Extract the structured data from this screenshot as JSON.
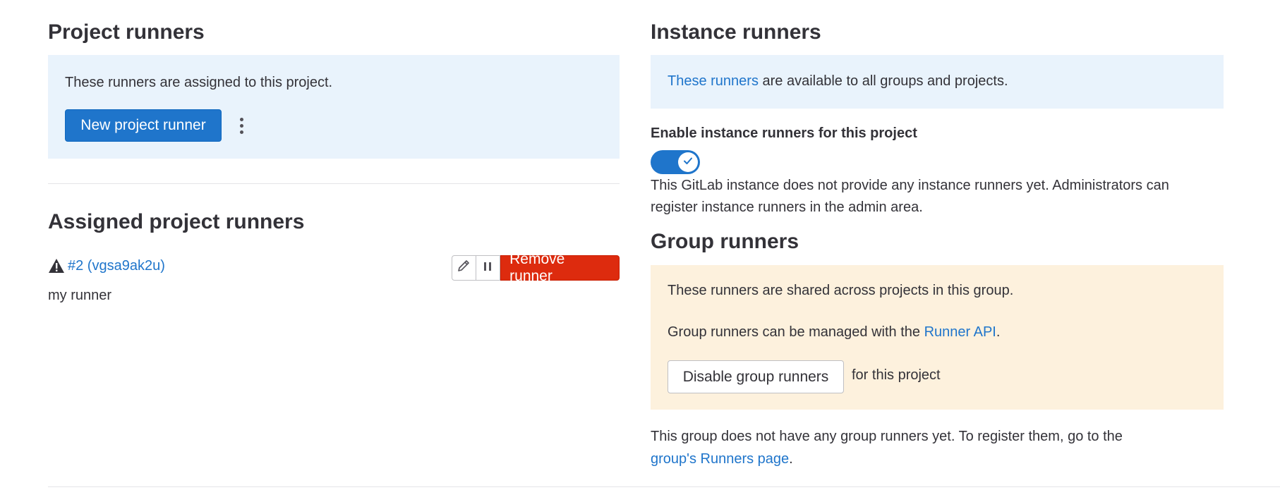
{
  "project_runners": {
    "title": "Project runners",
    "info_text": "These runners are assigned to this project.",
    "new_button": "New project runner"
  },
  "assigned": {
    "title": "Assigned project runners",
    "runner": {
      "link": "#2 (vgsa9ak2u)",
      "description": "my runner",
      "remove_button": "Remove runner"
    }
  },
  "instance_runners": {
    "title": "Instance runners",
    "info_link": "These runners",
    "info_text": " are available to all groups and projects.",
    "toggle_label": "Enable instance runners for this project",
    "toggle_on": true,
    "note_line1": "This GitLab instance does not provide any instance runners yet. Administrators can",
    "note_line2": "register instance runners in the admin area."
  },
  "group_runners": {
    "title": "Group runners",
    "shared_text": "These runners are shared across projects in this group.",
    "managed_prefix": "Group runners can be managed with the ",
    "managed_link": "Runner API",
    "managed_suffix": ".",
    "disable_button": "Disable group runners",
    "disable_suffix": "for this project",
    "none_line1": "This group does not have any group runners yet. To register them, go to the",
    "none_link": "group's Runners page",
    "none_suffix": "."
  },
  "colors": {
    "primary": "#1f75cb",
    "danger": "#dd2b0e",
    "info_bg": "#e9f3fc",
    "warning_bg": "#fdf1dd"
  }
}
